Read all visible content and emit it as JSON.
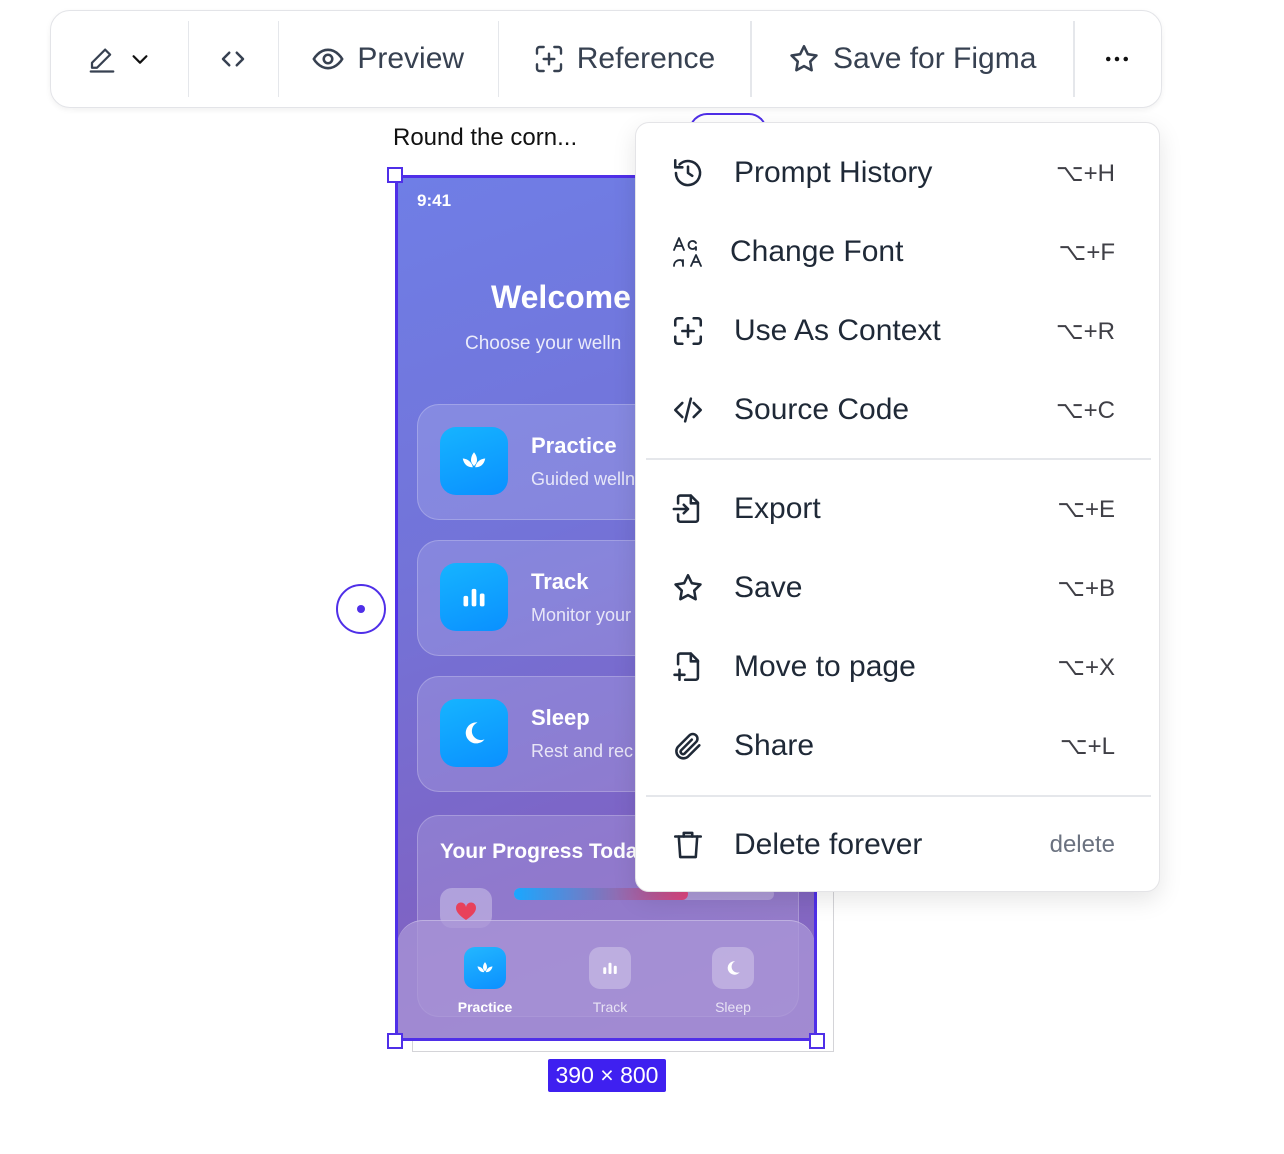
{
  "toolbar": {
    "preview_label": "Preview",
    "reference_label": "Reference",
    "save_figma_label": "Save for Figma"
  },
  "frame": {
    "label": "Round the corn...",
    "dimensions": "390 × 800"
  },
  "phone": {
    "time": "9:41",
    "welcome": "Welcome",
    "choose": "Choose your welln",
    "cards": [
      {
        "title": "Practice",
        "subtitle": "Guided welln"
      },
      {
        "title": "Track",
        "subtitle": "Monitor your"
      },
      {
        "title": "Sleep",
        "subtitle": "Rest and rec"
      }
    ],
    "progress": {
      "title": "Your Progress Toda",
      "value": 0.67
    },
    "tabs": [
      {
        "label": "Practice",
        "active": true
      },
      {
        "label": "Track",
        "active": false
      },
      {
        "label": "Sleep",
        "active": false
      }
    ]
  },
  "menu": {
    "items": [
      {
        "label": "Prompt History",
        "shortcut": "⌥+H",
        "icon": "history-icon"
      },
      {
        "label": "Change Font",
        "shortcut": "⌥+F",
        "icon": "font-icon"
      },
      {
        "label": "Use As Context",
        "shortcut": "⌥+R",
        "icon": "context-icon"
      },
      {
        "label": "Source Code",
        "shortcut": "⌥+C",
        "icon": "code-icon"
      },
      {
        "label": "Export",
        "shortcut": "⌥+E",
        "icon": "export-icon"
      },
      {
        "label": "Save",
        "shortcut": "⌥+B",
        "icon": "star-icon"
      },
      {
        "label": "Move to page",
        "shortcut": "⌥+X",
        "icon": "file-plus-icon"
      },
      {
        "label": "Share",
        "shortcut": "⌥+L",
        "icon": "paperclip-icon"
      },
      {
        "label": "Delete forever",
        "shortcut": "delete",
        "icon": "trash-icon"
      }
    ]
  },
  "colors": {
    "selection": "#4f2fe8",
    "dims_badge": "#3f20f0",
    "app_accent": "#0a90ff"
  }
}
